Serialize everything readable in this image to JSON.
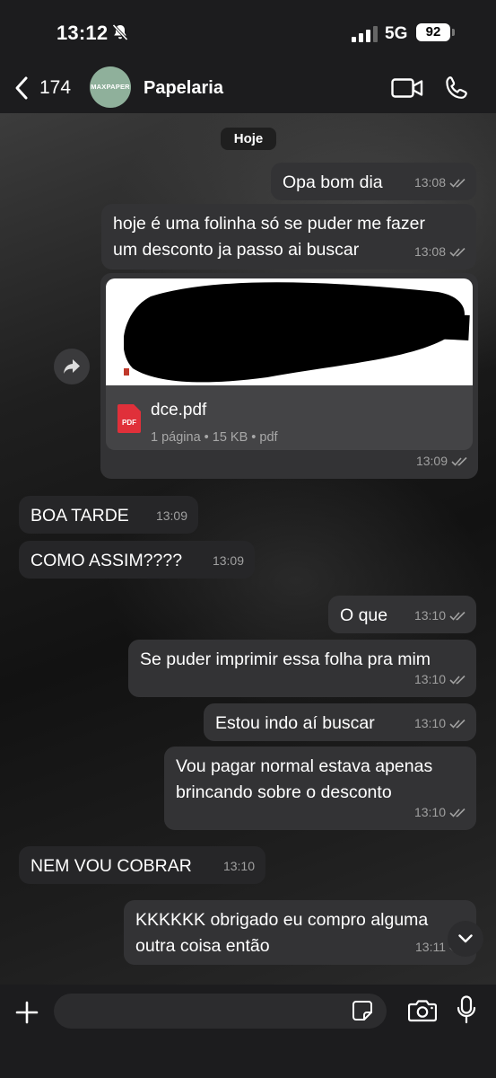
{
  "status_bar": {
    "time": "13:12",
    "network": "5G",
    "battery": "92"
  },
  "header": {
    "back_count": "174",
    "contact_name": "Papelaria",
    "avatar_text": "MAXPAPER"
  },
  "chat": {
    "day_label": "Hoje",
    "messages": [
      {
        "direction": "out",
        "lines": [
          "Opa bom dia"
        ],
        "time": "13:08",
        "read": true
      },
      {
        "direction": "out",
        "lines": [
          "hoje é uma folinha só se puder me fazer",
          "um desconto ja passo ai buscar"
        ],
        "time": "13:08",
        "read": true
      },
      {
        "direction": "out",
        "type": "file",
        "file": {
          "name": "dce.pdf",
          "meta": "1 página • 15 KB • pdf",
          "icon_label": "PDF"
        },
        "time": "13:09",
        "read": true
      },
      {
        "direction": "in",
        "lines": [
          "BOA TARDE"
        ],
        "time": "13:09"
      },
      {
        "direction": "in",
        "lines": [
          "COMO ASSIM????"
        ],
        "time": "13:09"
      },
      {
        "direction": "out",
        "lines": [
          "O que"
        ],
        "time": "13:10",
        "read": true
      },
      {
        "direction": "out",
        "lines": [
          "Se puder imprimir essa folha pra mim"
        ],
        "time": "13:10",
        "read": true
      },
      {
        "direction": "out",
        "lines": [
          "Estou indo aí buscar"
        ],
        "time": "13:10",
        "read": true
      },
      {
        "direction": "out",
        "lines": [
          "Vou pagar normal estava apenas",
          "brincando sobre o desconto"
        ],
        "time": "13:10",
        "read": true
      },
      {
        "direction": "in",
        "lines": [
          "NEM VOU COBRAR"
        ],
        "time": "13:10"
      },
      {
        "direction": "out",
        "lines": [
          "KKKKKK obrigado eu compro alguma",
          "outra coisa então"
        ],
        "time": "13:11",
        "read": true
      }
    ]
  },
  "composer": {
    "placeholder": ""
  },
  "colors": {
    "bubble_out": "#333335",
    "bubble_in": "#262628",
    "bar_bg": "#1c1c1e",
    "read_ticks": "#a0a0a0",
    "pdf_red": "#e0303a"
  },
  "icons": [
    "bell-slash-icon",
    "signal-icon",
    "back-chevron-icon",
    "video-call-icon",
    "phone-icon",
    "share-forward-icon",
    "pdf-file-icon",
    "double-check-icon",
    "chevron-down-icon",
    "plus-icon",
    "sticker-icon",
    "camera-icon",
    "microphone-icon"
  ]
}
